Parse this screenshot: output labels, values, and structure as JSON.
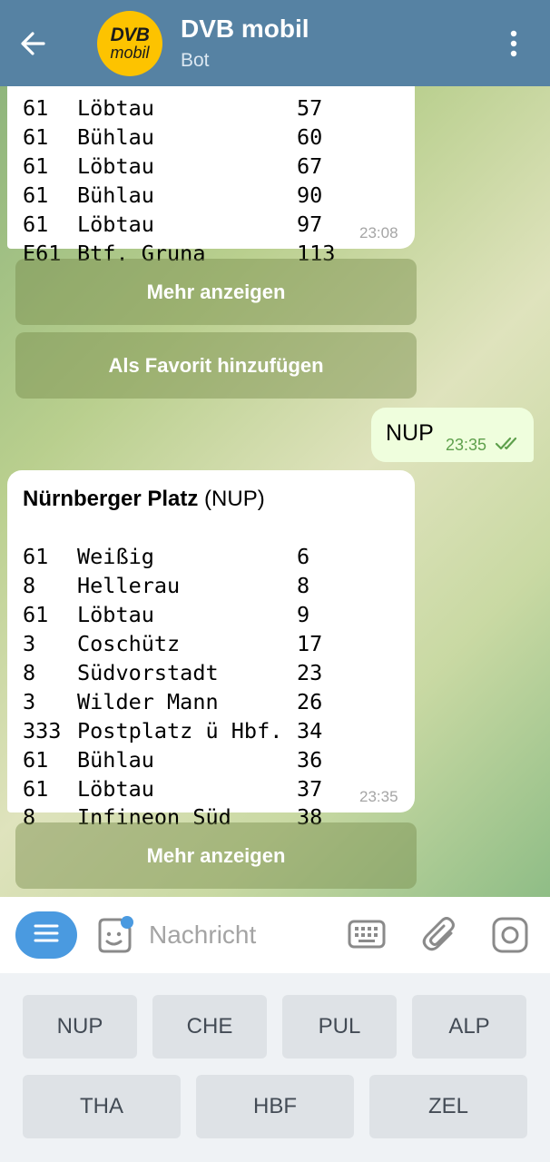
{
  "header": {
    "title": "DVB mobil",
    "subtitle": "Bot",
    "avatar_line1": "DVB",
    "avatar_line2": "mobil"
  },
  "messages": {
    "first": {
      "rows": [
        [
          "61",
          "Löbtau",
          "57"
        ],
        [
          "61",
          "Bühlau",
          "60"
        ],
        [
          "61",
          "Löbtau",
          "67"
        ],
        [
          "61",
          "Bühlau",
          "90"
        ],
        [
          "61",
          "Löbtau",
          "97"
        ],
        [
          "E61",
          "Btf. Gruna",
          "113"
        ]
      ],
      "time": "23:08"
    },
    "buttons1": {
      "more": "Mehr anzeigen",
      "favorite": "Als Favorit hinzufügen"
    },
    "outgoing": {
      "text": "NUP",
      "time": "23:35"
    },
    "second": {
      "title_bold": "Nürnberger Platz",
      "title_rest": " (NUP)",
      "rows": [
        [
          "61",
          "Weißig",
          "6"
        ],
        [
          "8",
          "Hellerau",
          "8"
        ],
        [
          "61",
          "Löbtau",
          "9"
        ],
        [
          "3",
          "Coschütz",
          "17"
        ],
        [
          "8",
          "Südvorstadt",
          "23"
        ],
        [
          "3",
          "Wilder Mann",
          "26"
        ],
        [
          "333",
          "Postplatz ü Hbf.",
          "34"
        ],
        [
          "61",
          "Bühlau",
          "36"
        ],
        [
          "61",
          "Löbtau",
          "37"
        ],
        [
          "8",
          "Infineon Süd",
          "38"
        ]
      ],
      "time": "23:35"
    },
    "buttons2": {
      "more": "Mehr anzeigen"
    }
  },
  "input": {
    "placeholder": "Nachricht"
  },
  "keyboard": {
    "row1": [
      "NUP",
      "CHE",
      "PUL",
      "ALP"
    ],
    "row2": [
      "THA",
      "HBF",
      "ZEL"
    ]
  },
  "colors": {
    "header": "#5682a3",
    "accent": "#4a9ae0",
    "outgoing_bubble": "#effedd"
  },
  "icons": [
    "back-arrow-icon",
    "more-vert-icon",
    "menu-icon",
    "sticker-icon",
    "keyboard-icon",
    "paperclip-icon",
    "camera-icon",
    "double-check-icon"
  ]
}
